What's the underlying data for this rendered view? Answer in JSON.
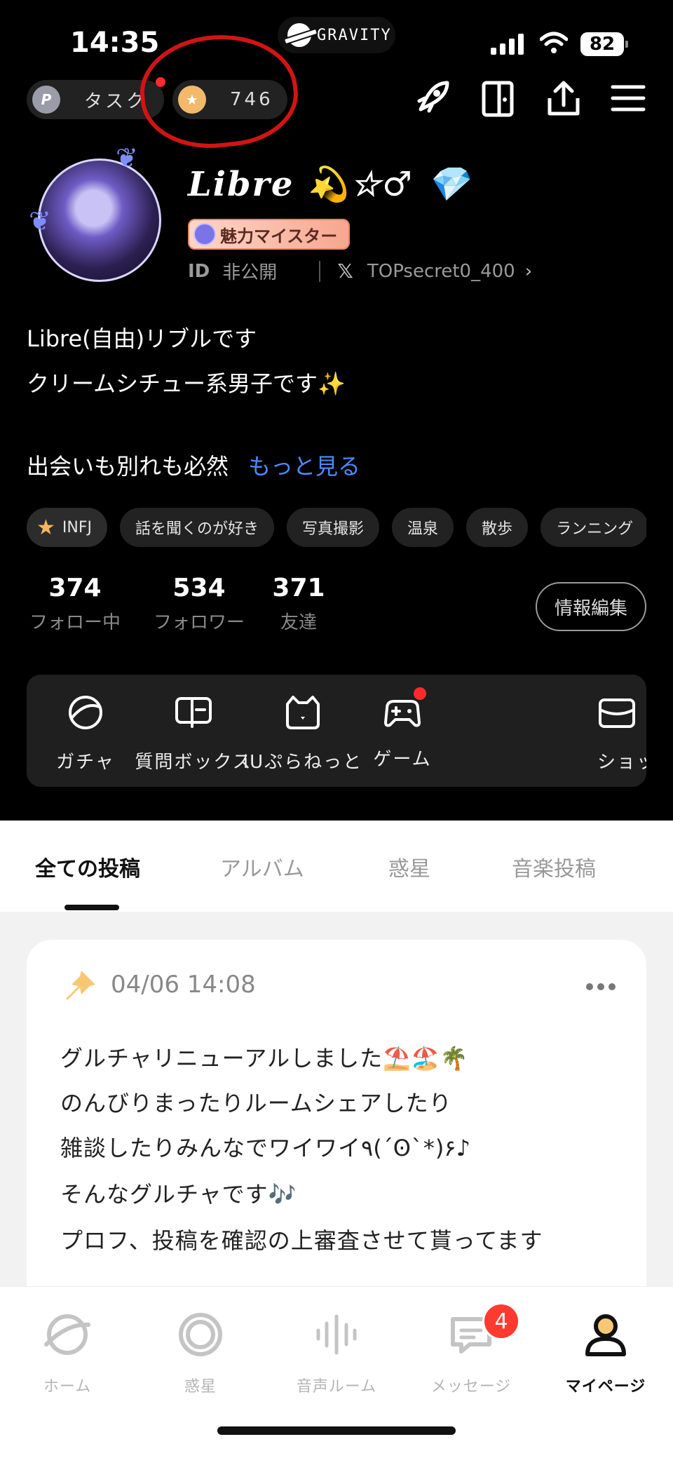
{
  "status_bar": {
    "time": "14:35",
    "island_label": "GRAVITY",
    "battery": "82"
  },
  "header": {
    "task_label": "タスク",
    "task_icon_letter": "P",
    "coin_count": "746"
  },
  "profile": {
    "name": "Libre 💫☆♂ 💎",
    "badge": "魅力マイスター",
    "id_key": "ID",
    "id_value": "非公開",
    "x_handle": "TOPsecret0_400",
    "bio_lines": [
      "Libre(自由)リブルです",
      "クリームシチュー系男子です✨",
      "出会いも別れも必然"
    ],
    "more": "もっと見る"
  },
  "tags": [
    "INFJ",
    "話を聞くのが好き",
    "写真撮影",
    "温泉",
    "散歩",
    "ランニング"
  ],
  "stats": [
    {
      "num": "374",
      "label": "フォロー中"
    },
    {
      "num": "534",
      "label": "フォロワー"
    },
    {
      "num": "371",
      "label": "友達"
    }
  ],
  "edit_button": "情報編集",
  "features": [
    {
      "label": "ガチャ",
      "icon": "gacha-icon"
    },
    {
      "label": "質問ボックス",
      "icon": "question-box-icon"
    },
    {
      "label": "iUぷらねっと",
      "icon": "bear-icon"
    },
    {
      "label": "ゲーム",
      "icon": "gamepad-icon"
    },
    {
      "label": "ショップ",
      "icon": "shop-icon"
    }
  ],
  "tabs": [
    "全ての投稿",
    "アルバム",
    "惑星",
    "音楽投稿"
  ],
  "post": {
    "date": "04/06 14:08",
    "lines": [
      "グルチャリニューアルしました⛱️🏖️🌴",
      "のんびりまったりルームシェアしたり",
      "雑談したりみんなでワイワイ٩(´Ꙩ`*)۶♪",
      "そんなグルチャです🎶",
      "プロフ、投稿を確認の上審査させて貰ってます"
    ]
  },
  "nav": [
    {
      "label": "ホーム",
      "icon": "planet-icon"
    },
    {
      "label": "惑星",
      "icon": "ring-icon"
    },
    {
      "label": "音声ルーム",
      "icon": "voice-icon"
    },
    {
      "label": "メッセージ",
      "icon": "message-icon",
      "badge": "4"
    },
    {
      "label": "マイページ",
      "icon": "profile-icon"
    }
  ],
  "colors": {
    "accent_link": "#4d8bff",
    "badge_red": "#ff3b30",
    "annotation_circle": "#d21414"
  }
}
